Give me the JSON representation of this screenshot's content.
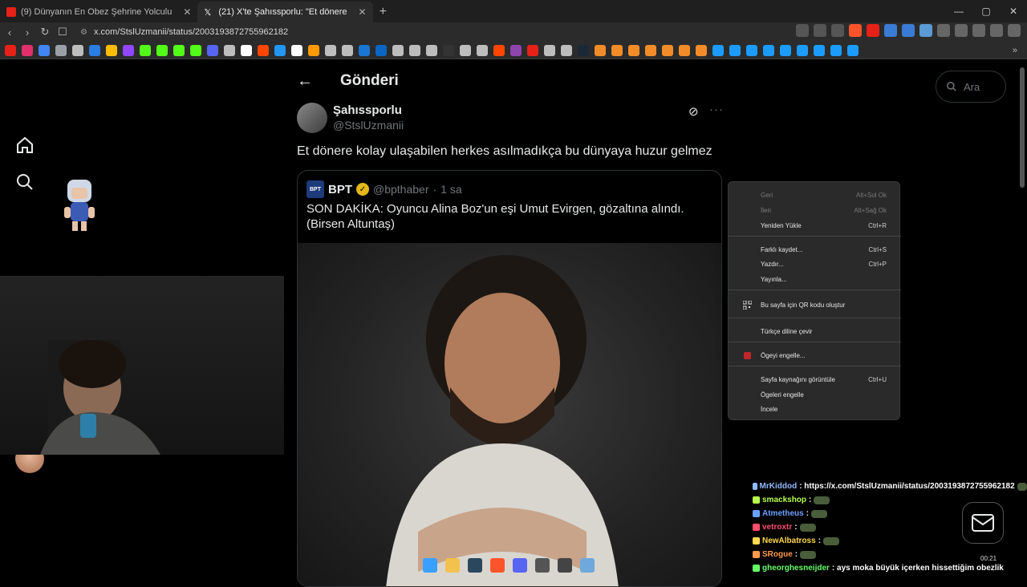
{
  "browser": {
    "tabs": [
      {
        "label": "(9) Dünyanın En Obez Şehrine Yolculu",
        "color": "#e62117",
        "active": false
      },
      {
        "label": "(21) X'te Şahıssporlu: \"Et dönere",
        "color": "#ffffff",
        "active": true
      }
    ],
    "new_tab": "+",
    "url": "x.com/StslUzmanii/status/2003193872755962182",
    "bookmark_colors": [
      "#e62117",
      "#e1306c",
      "#4285f4",
      "#9aa0a6",
      "#bdbdbd",
      "#2a7de1",
      "#fbbc04",
      "#9146ff",
      "#53fc18",
      "#53fc18",
      "#53fc18",
      "#53fc18",
      "#5865f2",
      "#bdbdbd",
      "#ffffff",
      "#ff4500",
      "#2196f3",
      "#ffffff",
      "#ff9900",
      "#bdbdbd",
      "#bdbdbd",
      "#1976d2",
      "#0a66c2",
      "#bdbdbd",
      "#bdbdbd",
      "#bdbdbd",
      "#333333",
      "#bdbdbd",
      "#bdbdbd",
      "#ff4500",
      "#8e44ad",
      "#e62117",
      "#bdbdbd",
      "#bdbdbd",
      "#1b2838",
      "#f28c28",
      "#f28c28",
      "#f28c28",
      "#f28c28",
      "#f28c28",
      "#f28c28",
      "#f28c28",
      "#1b9cfc",
      "#1b9cfc",
      "#1b9cfc",
      "#1b9cfc",
      "#1b9cfc",
      "#1b9cfc",
      "#1b9cfc",
      "#1b9cfc",
      "#1b9cfc"
    ],
    "bookmarks_more": "»"
  },
  "x": {
    "header_title": "Gönderi",
    "search_placeholder": "Ara",
    "author_name": "Şahıssporlu",
    "author_handle": "@StslUzmanii",
    "tweet_text": "Et dönere kolay ulaşabilen herkes asılmadıkça bu dünyaya huzur gelmez",
    "quote": {
      "logo_text": "BPT",
      "name": "BPT",
      "handle": "@bpthaber",
      "separator": "·",
      "time": "1 sa",
      "text": "SON DAKİKA: Oyuncu Alina Boz'un eşi Umut Evirgen, gözaltına alındı. (Birsen Altuntaş)"
    }
  },
  "context_menu": {
    "items": [
      {
        "label": "Geri",
        "shortcut": "Alt+Sol Ok",
        "disabled": true
      },
      {
        "label": "İleri",
        "shortcut": "Alt+Sağ Ok",
        "disabled": true
      },
      {
        "label": "Yeniden Yükle",
        "shortcut": "Ctrl+R",
        "disabled": false
      },
      {
        "label": "Farklı kaydet...",
        "shortcut": "Ctrl+S",
        "disabled": false
      },
      {
        "label": "Yazdır...",
        "shortcut": "Ctrl+P",
        "disabled": false
      },
      {
        "label": "Yayınla...",
        "shortcut": "",
        "disabled": false
      },
      {
        "label": "Bu sayfa için QR kodu oluştur",
        "shortcut": "",
        "disabled": false
      },
      {
        "label": "Türkçe diline çevir",
        "shortcut": "",
        "disabled": false
      },
      {
        "label": "Ögeyi engelle...",
        "shortcut": "",
        "disabled": false
      },
      {
        "label": "Sayfa kaynağını görüntüle",
        "shortcut": "Ctrl+U",
        "disabled": false
      },
      {
        "label": "Ögeleri engelle",
        "shortcut": "",
        "disabled": false
      },
      {
        "label": "İncele",
        "shortcut": "",
        "disabled": false
      }
    ]
  },
  "chat": [
    {
      "user": "MrKiddod",
      "color": "#8fb8ff",
      "message": " : https://x.com/StslUzmanii/status/2003193872755962182"
    },
    {
      "user": "smackshop",
      "color": "#b8ff4d",
      "message": " :"
    },
    {
      "user": "Atmetheus",
      "color": "#6aa0ff",
      "message": " :"
    },
    {
      "user": "vetroxtr",
      "color": "#ff4d6d",
      "message": " :"
    },
    {
      "user": "NewAlbatross",
      "color": "#ffd84d",
      "message": " :"
    },
    {
      "user": "SRogue",
      "color": "#ff9a4d",
      "message": " :"
    },
    {
      "user": "gheorghesneijder",
      "color": "#66ff66",
      "message": " : ays moka büyük içerken hissettiğim obezlik"
    }
  ],
  "system": {
    "clock": "00:21"
  }
}
